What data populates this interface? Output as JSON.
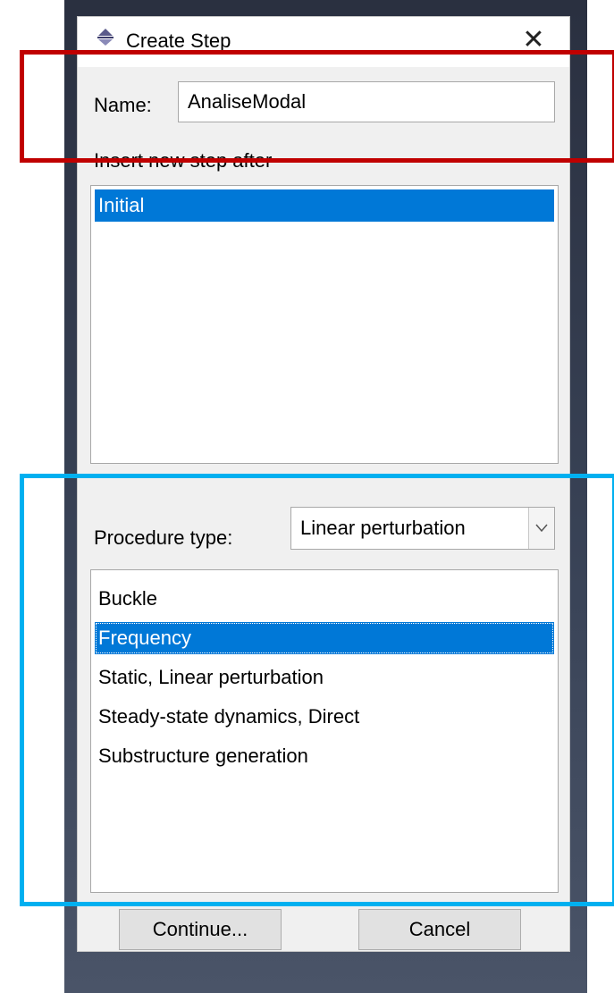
{
  "dialog": {
    "title": "Create Step",
    "title_icon": "step-icon",
    "close_glyph": "✕"
  },
  "name_field": {
    "label": "Name:",
    "value": "AnaliseModal"
  },
  "insert_after": {
    "label": "Insert new step after",
    "items": [
      {
        "label": "Initial",
        "selected": true
      }
    ]
  },
  "procedure_type": {
    "label": "Procedure type:",
    "selected": "Linear perturbation"
  },
  "procedures": {
    "items": [
      {
        "label": "Buckle",
        "selected": false
      },
      {
        "label": "Frequency",
        "selected": true
      },
      {
        "label": "Static, Linear perturbation",
        "selected": false
      },
      {
        "label": "Steady-state dynamics, Direct",
        "selected": false
      },
      {
        "label": "Substructure generation",
        "selected": false
      }
    ]
  },
  "buttons": {
    "continue": "Continue...",
    "cancel": "Cancel"
  },
  "colors": {
    "selection": "#0078d7",
    "highlight_red": "#c00000",
    "highlight_blue": "#00b0f0"
  }
}
